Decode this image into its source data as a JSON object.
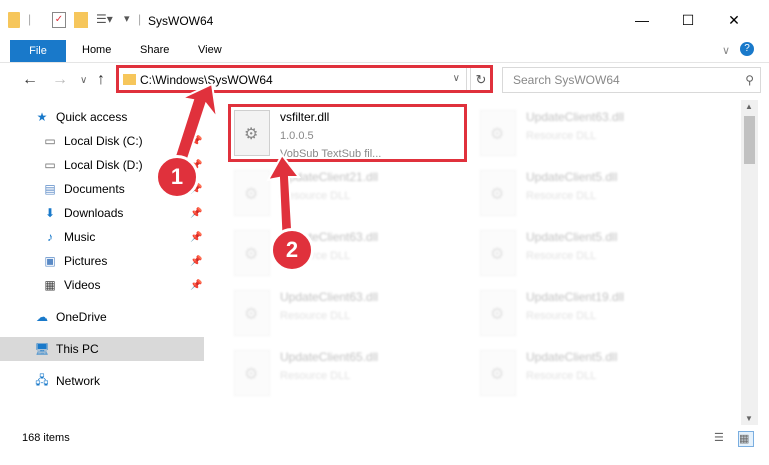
{
  "window": {
    "title": "SysWOW64",
    "minimize": "—",
    "maximize": "☐",
    "close": "✕"
  },
  "ribbon": {
    "file": "File",
    "home": "Home",
    "share": "Share",
    "view": "View"
  },
  "nav": {
    "address": "C:\\Windows\\SysWOW64",
    "search_placeholder": "Search SysWOW64"
  },
  "sidebar": {
    "quick_access": "Quick access",
    "items": [
      {
        "label": "Local Disk (C:)"
      },
      {
        "label": "Local Disk (D:)"
      },
      {
        "label": "Documents"
      },
      {
        "label": "Downloads"
      },
      {
        "label": "Music"
      },
      {
        "label": "Pictures"
      },
      {
        "label": "Videos"
      }
    ],
    "onedrive": "OneDrive",
    "thispc": "This PC",
    "network": "Network"
  },
  "files": {
    "highlighted": {
      "name": "vsfilter.dll",
      "version": "1.0.0.5",
      "desc": "VobSub   TextSub fil..."
    },
    "left_col": [
      {
        "name": "UpdateClient21.dll",
        "type": "Resource DLL"
      },
      {
        "name": "UpdateClient63.dll",
        "type": "Resource DLL"
      },
      {
        "name": "UpdateClient63.dll",
        "type": "Resource DLL"
      },
      {
        "name": "UpdateClient65.dll",
        "type": "Resource DLL"
      }
    ],
    "right_col": [
      {
        "name": "UpdateClient63.dll",
        "type": "Resource DLL"
      },
      {
        "name": "UpdateClient5.dll",
        "type": "Resource DLL"
      },
      {
        "name": "UpdateClient5.dll",
        "type": "Resource DLL"
      },
      {
        "name": "UpdateClient19.dll",
        "type": "Resource DLL"
      },
      {
        "name": "UpdateClient5.dll",
        "type": "Resource DLL"
      }
    ]
  },
  "status": {
    "items": "168 items"
  },
  "callouts": {
    "one": "1",
    "two": "2"
  },
  "colors": {
    "accent": "#1979ca",
    "highlight": "#e0313c"
  }
}
